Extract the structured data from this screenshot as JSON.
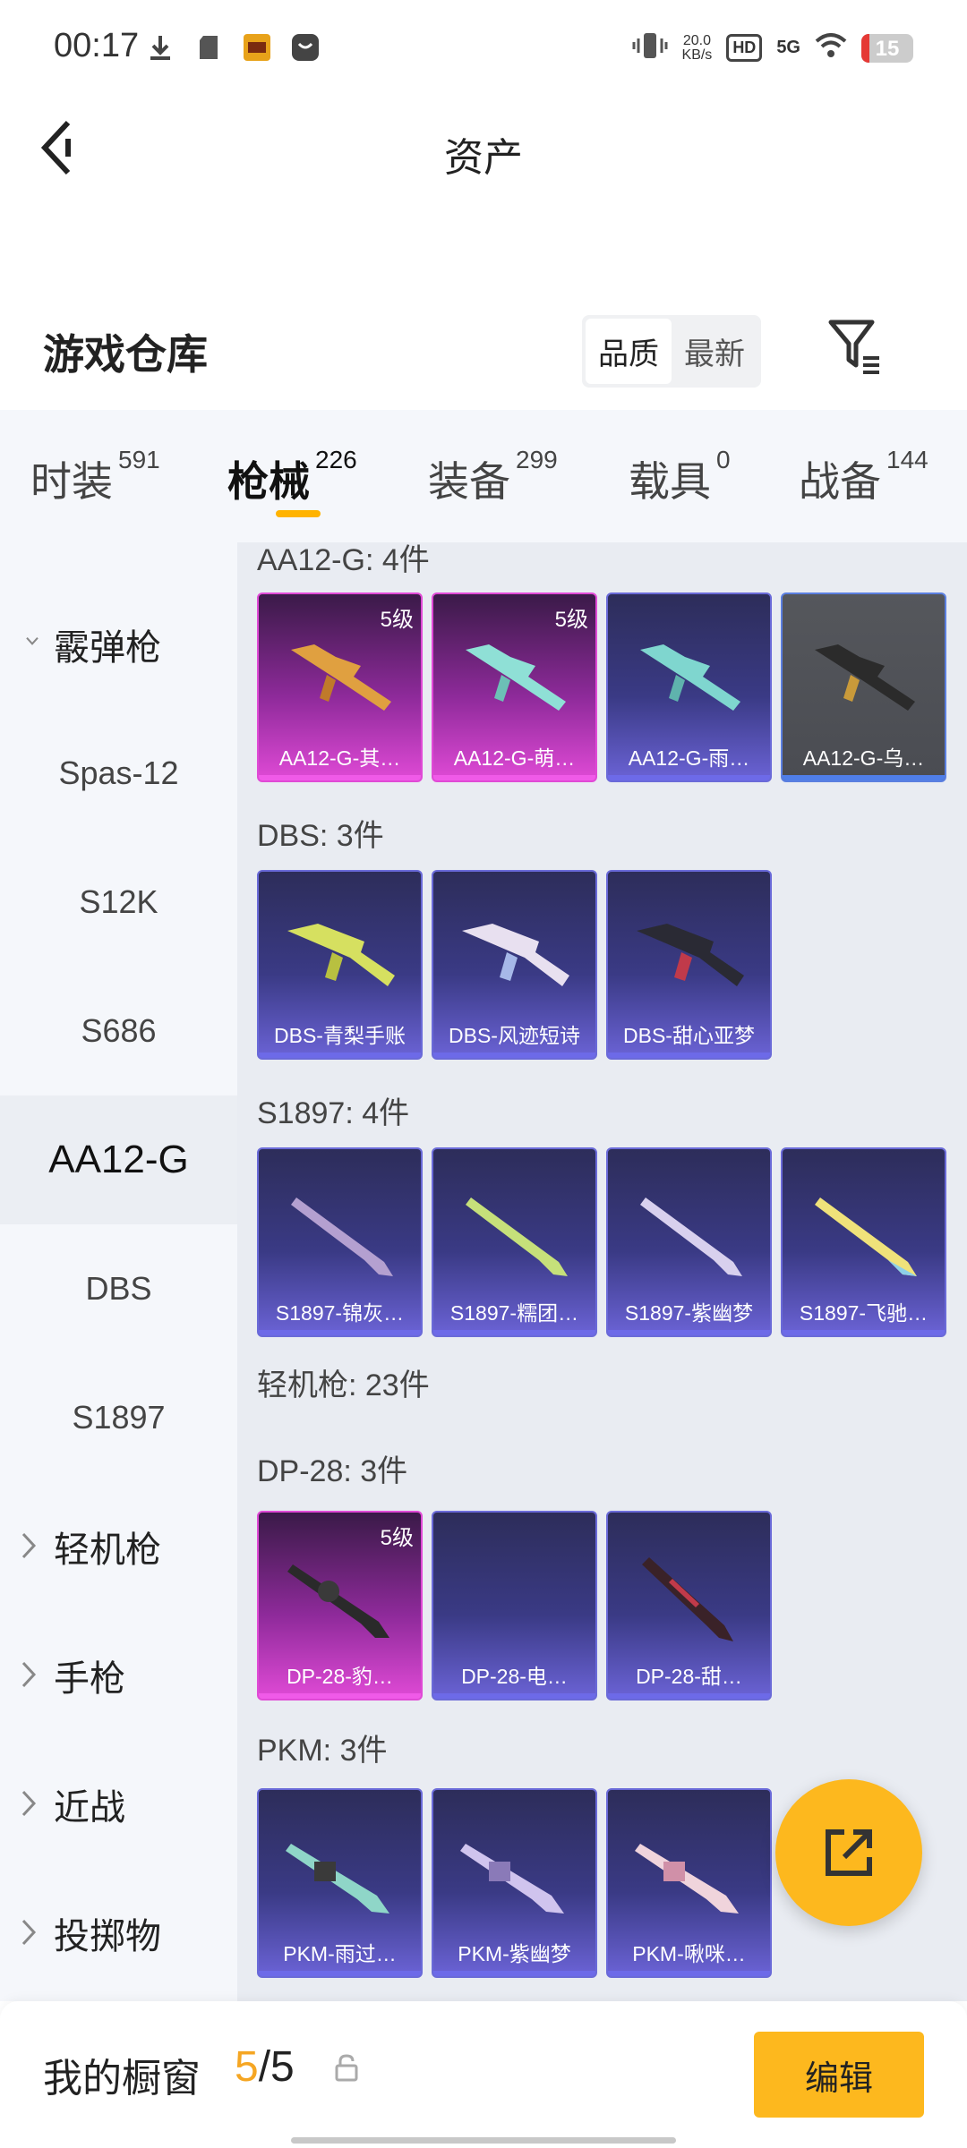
{
  "status_bar": {
    "time": "00:17",
    "speed_value": "20.0",
    "speed_unit": "KB/s",
    "hd_badge": "HD",
    "network": "5G",
    "battery": "15",
    "battery_level": 0.15,
    "battery_color": "#e53935"
  },
  "header": {
    "title": "资产"
  },
  "section": {
    "title": "游戏仓库",
    "sort_quality": "品质",
    "sort_newest": "最新"
  },
  "tabs": [
    {
      "label": "时装",
      "count": "591"
    },
    {
      "label": "枪械",
      "count": "226"
    },
    {
      "label": "装备",
      "count": "299"
    },
    {
      "label": "载具",
      "count": "0"
    },
    {
      "label": "战备",
      "count": "144"
    }
  ],
  "sidebar": {
    "shotgun_group": "霰弹枪",
    "items": [
      "Spas-12",
      "S12K",
      "S686",
      "AA12-G",
      "DBS",
      "S1897"
    ],
    "lmg_group": "轻机枪",
    "pistol_group": "手枪",
    "melee_group": "近战",
    "throwable_group": "投掷物"
  },
  "groups": {
    "aa12": {
      "heading": "AA12-G: 4件",
      "cards": [
        {
          "name": "AA12-G-其…",
          "level": "5级"
        },
        {
          "name": "AA12-G-萌…",
          "level": "5级"
        },
        {
          "name": "AA12-G-雨…"
        },
        {
          "name": "AA12-G-乌…"
        }
      ]
    },
    "dbs": {
      "heading": "DBS: 3件",
      "cards": [
        {
          "name": "DBS-青梨手账"
        },
        {
          "name": "DBS-风迹短诗"
        },
        {
          "name": "DBS-甜心亚梦"
        }
      ]
    },
    "s1897": {
      "heading": "S1897: 4件",
      "cards": [
        {
          "name": "S1897-锦灰…"
        },
        {
          "name": "S1897-糯团…"
        },
        {
          "name": "S1897-紫幽梦"
        },
        {
          "name": "S1897-飞驰…"
        }
      ]
    },
    "lmg_heading": "轻机枪: 23件",
    "dp28": {
      "heading": "DP-28: 3件",
      "cards": [
        {
          "name": "DP-28-豹…",
          "level": "5级"
        },
        {
          "name": "DP-28-电…"
        },
        {
          "name": "DP-28-甜…"
        }
      ]
    },
    "pkm": {
      "heading": "PKM: 3件",
      "cards": [
        {
          "name": "PKM-雨过…"
        },
        {
          "name": "PKM-紫幽梦"
        },
        {
          "name": "PKM-啾咪…"
        }
      ]
    }
  },
  "bottom": {
    "window_label": "我的橱窗",
    "used": "5",
    "separator": "/",
    "total": "5",
    "edit_label": "编辑"
  },
  "colors": {
    "accent": "#fdb81e",
    "rare_purple": "#6b63d6",
    "legendary_pink": "#e04ad6"
  }
}
